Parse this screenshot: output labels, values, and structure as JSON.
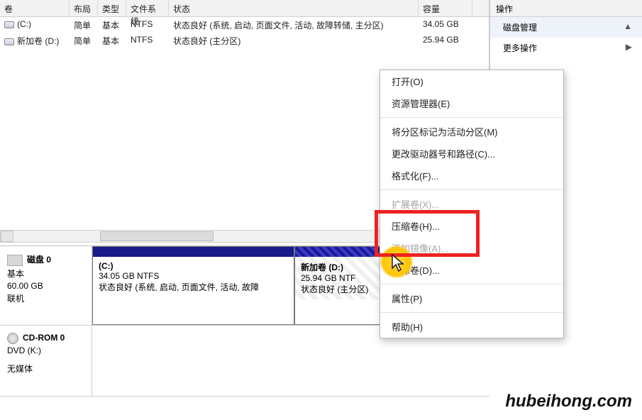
{
  "table": {
    "headers": [
      "卷",
      "布局",
      "类型",
      "文件系统",
      "状态",
      "容量"
    ],
    "rows": [
      {
        "vol": "(C:)",
        "layout": "简单",
        "type": "基本",
        "fs": "NTFS",
        "status": "状态良好 (系统, 启动, 页面文件, 活动, 故障转储, 主分区)",
        "cap": "34.05 GB"
      },
      {
        "vol": "新加卷 (D:)",
        "layout": "简单",
        "type": "基本",
        "fs": "NTFS",
        "status": "状态良好 (主分区)",
        "cap": "25.94 GB"
      }
    ]
  },
  "actions": {
    "header": "操作",
    "items": [
      {
        "label": "磁盘管理",
        "arrow": "▲",
        "hl": true
      },
      {
        "label": "更多操作",
        "arrow": "▶",
        "hl": false
      }
    ]
  },
  "disk0": {
    "title": "磁盘 0",
    "type": "基本",
    "size": "60.00 GB",
    "state": "联机",
    "parts": [
      {
        "name": "(C:)",
        "size": "34.05 GB NTFS",
        "status": "状态良好 (系统, 启动, 页面文件, 活动, 故障"
      },
      {
        "name": "新加卷  (D:)",
        "size": "25.94 GB NTF",
        "status": "状态良好 (主分区)"
      }
    ]
  },
  "cdrom": {
    "title": "CD-ROM 0",
    "type": "DVD (K:)",
    "state": "无媒体"
  },
  "ctx": {
    "open": "打开(O)",
    "explorer": "资源管理器(E)",
    "mark_active": "将分区标记为活动分区(M)",
    "change_letter": "更改驱动器号和路径(C)...",
    "format": "格式化(F)...",
    "extend": "扩展卷(X)...",
    "shrink": "压缩卷(H)...",
    "add_mirror": "添加镜像(A)...",
    "delete_vol": "删除卷(D)...",
    "properties": "属性(P)",
    "help": "帮助(H)"
  },
  "watermark": "hubeihong.com"
}
